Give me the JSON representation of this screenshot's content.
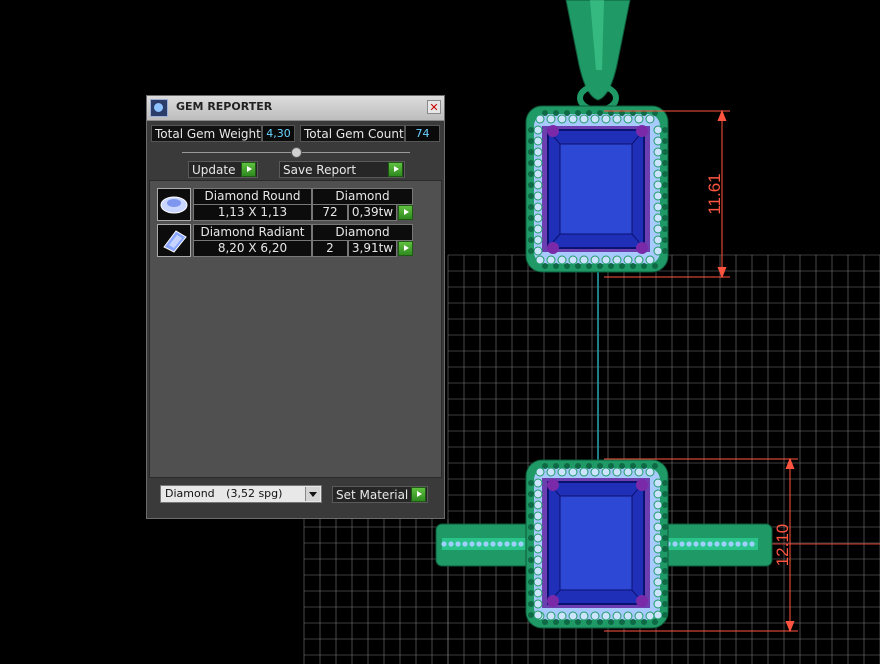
{
  "viewport": {
    "dimension_top": "11.61",
    "dimension_bottom": "12.10",
    "colors": {
      "metal": "#1f9a66",
      "stone": "#1f2fb8",
      "halo": "#b9d9ff",
      "prong": "#7a2aa8",
      "grid": "#8a8a8a",
      "dimension": "#ff5540",
      "axis": "#2aa7b3"
    }
  },
  "gem_reporter": {
    "title": "GEM REPORTER",
    "close_icon": "close-icon",
    "total_weight_label": "Total Gem Weight",
    "total_weight_value": "4,30",
    "total_count_label": "Total Gem Count",
    "total_count_value": "74",
    "update_label": "Update",
    "save_report_label": "Save Report",
    "gems": [
      {
        "icon": "round-gem-icon",
        "name": "Diamond Round",
        "material": "Diamond",
        "size": "1,13 X 1,13",
        "count": "72",
        "weight": "0,39tw"
      },
      {
        "icon": "radiant-gem-icon",
        "name": "Diamond Radiant",
        "material": "Diamond",
        "size": "8,20 X 6,20",
        "count": "2",
        "weight": "3,91tw"
      }
    ],
    "material_select": {
      "name": "Diamond",
      "spg": "(3,52 spg)"
    },
    "set_material_label": "Set Material"
  }
}
